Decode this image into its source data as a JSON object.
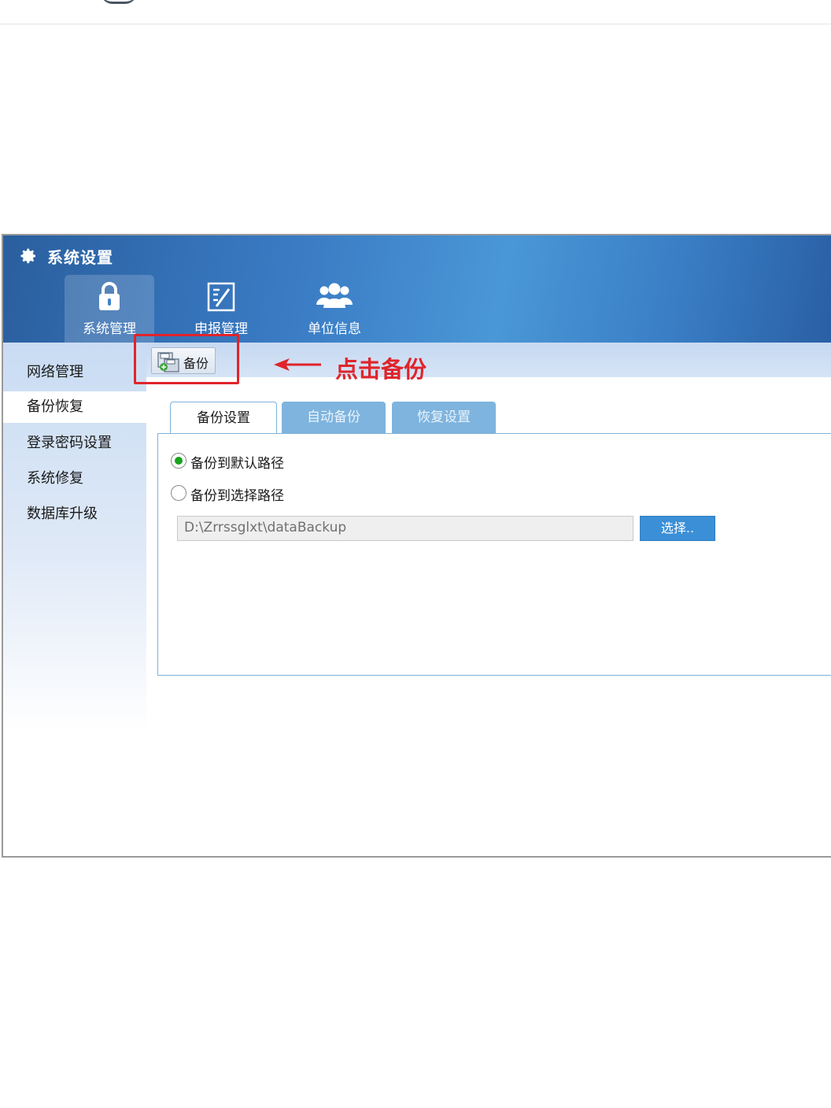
{
  "window": {
    "title": "系统设置"
  },
  "ribbon": {
    "items": [
      {
        "label": "系统管理",
        "icon": "lock-icon",
        "active": true
      },
      {
        "label": "申报管理",
        "icon": "edit-document-icon",
        "active": false
      },
      {
        "label": "单位信息",
        "icon": "users-icon",
        "active": false
      }
    ]
  },
  "sidebar": {
    "items": [
      {
        "label": "网络管理"
      },
      {
        "label": "备份恢复",
        "selected": true
      },
      {
        "label": "登录密码设置"
      },
      {
        "label": "系统修复"
      },
      {
        "label": "数据库升级"
      }
    ]
  },
  "toolbar": {
    "backup_label": "备份"
  },
  "annotation": {
    "text": "点击备份",
    "color": "#e0242b"
  },
  "tabs": [
    {
      "label": "备份设置",
      "active": true
    },
    {
      "label": "自动备份",
      "active": false
    },
    {
      "label": "恢复设置",
      "active": false
    }
  ],
  "backup_settings": {
    "option_default": "备份到默认路径",
    "option_select": "备份到选择路径",
    "selected_option": "default",
    "path_value": "D:\\Zrrssglxt\\dataBackup",
    "choose_button": "选择.."
  },
  "colors": {
    "title_gradient_start": "#2a5f9e",
    "title_gradient_mid": "#4a97d6",
    "radio_checked": "#17a31e",
    "choose_button": "#3b8fd6",
    "tab_inactive": "#7eb4de"
  }
}
